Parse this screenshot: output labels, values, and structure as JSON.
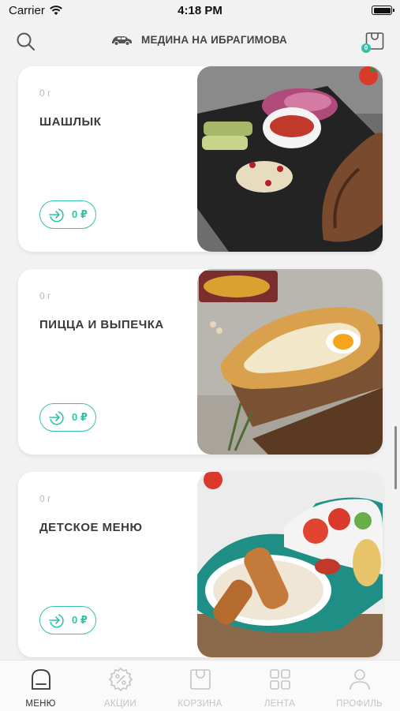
{
  "status_bar": {
    "carrier": "Carrier",
    "time": "4:18 PM"
  },
  "header": {
    "restaurant": "МЕДИНА НА ИБРАГИМОВА",
    "cart_count": "0"
  },
  "categories": [
    {
      "weight": "0 г",
      "title": "ШАШЛЫК",
      "price": "0 ₽",
      "image_icon": "grilled-meat-plate"
    },
    {
      "weight": "0 г",
      "title": "ПИЦЦА И ВЫПЕЧКА",
      "price": "0 ₽",
      "image_icon": "khachapuri-board"
    },
    {
      "weight": "0 г",
      "title": "ДЕТСКОЕ МЕНЮ",
      "price": "0 ₽",
      "image_icon": "kids-car-plate"
    }
  ],
  "tab_bar": [
    {
      "label": "МЕНЮ",
      "icon": "menu-icon",
      "active": true
    },
    {
      "label": "АКЦИИ",
      "icon": "discount-icon",
      "active": false
    },
    {
      "label": "КОРЗИНА",
      "icon": "cart-icon",
      "active": false
    },
    {
      "label": "ЛЕНТА",
      "icon": "feed-grid-icon",
      "active": false
    },
    {
      "label": "ПРОФИЛЬ",
      "icon": "profile-icon",
      "active": false
    }
  ],
  "colors": {
    "accent": "#33c2a8",
    "background": "#f2f2f2",
    "card": "#ffffff"
  }
}
